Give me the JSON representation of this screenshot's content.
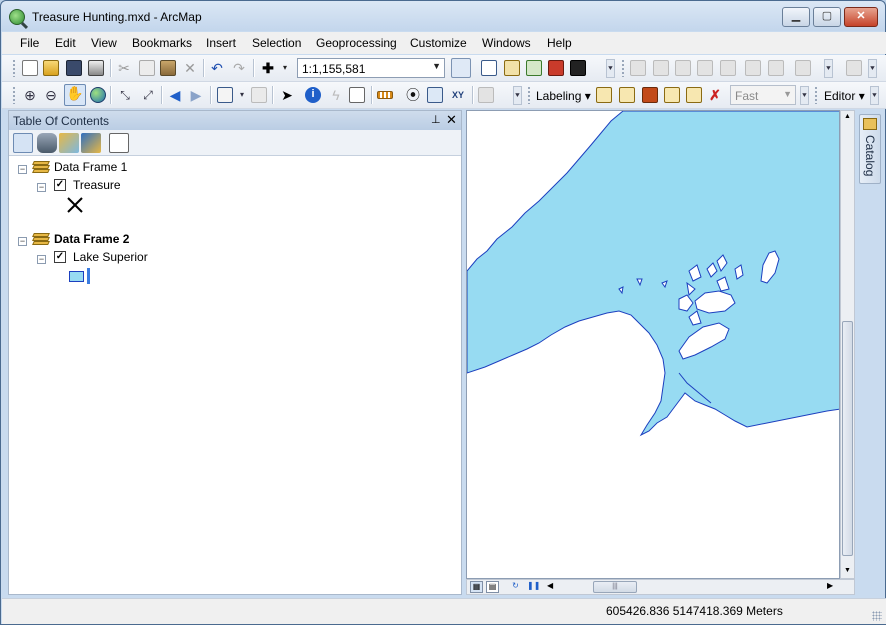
{
  "window": {
    "title": "Treasure Hunting.mxd - ArcMap"
  },
  "menu": [
    "File",
    "Edit",
    "View",
    "Bookmarks",
    "Insert",
    "Selection",
    "Geoprocessing",
    "Customize",
    "Windows",
    "Help"
  ],
  "toolbar": {
    "scale": "1:1,155,581",
    "labeling_label": "Labeling",
    "quality_value": "Fast",
    "editor_label": "Editor"
  },
  "toc": {
    "title": "Table Of Contents",
    "frames": [
      {
        "name": "Data Frame 1",
        "layers": [
          {
            "name": "Treasure",
            "checked": true
          }
        ]
      },
      {
        "name": "Data Frame 2",
        "layers": [
          {
            "name": "Lake Superior",
            "checked": true
          }
        ]
      }
    ]
  },
  "catalog_tab": {
    "label": "Catalog"
  },
  "status": {
    "coordinates": "605426.836  5147418.369 Meters"
  },
  "colors": {
    "lake_fill": "#97dbf2",
    "lake_outline": "#1c3fbf",
    "titlebar": "#c9dbef",
    "active_frame_bold": "#000000"
  },
  "icons": [
    "new-document-icon",
    "open-folder-icon",
    "save-icon",
    "print-icon",
    "cut-icon",
    "copy-icon",
    "paste-icon",
    "delete-icon",
    "undo-icon",
    "redo-icon",
    "add-data-icon",
    "zoom-in-icon",
    "zoom-out-icon",
    "pan-hand-icon",
    "full-extent-globe-icon",
    "identify-icon",
    "find-binoculars-icon",
    "catalog-icon"
  ]
}
